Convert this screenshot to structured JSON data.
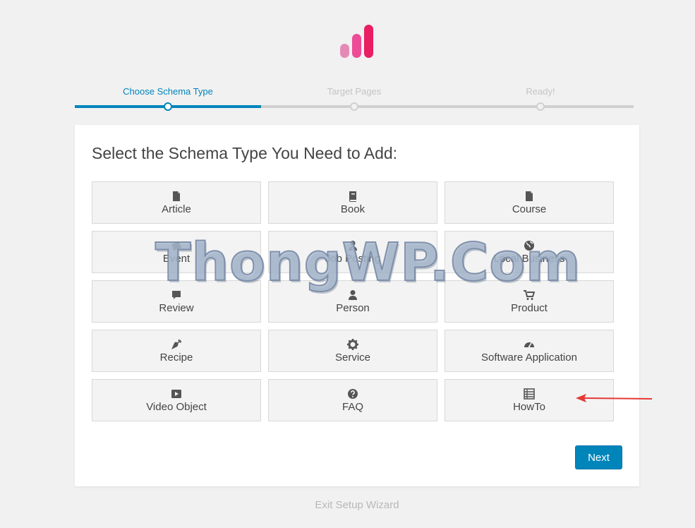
{
  "logo": {
    "bar_colors": [
      "#e58ab5",
      "#ec4d96",
      "#e91e63"
    ]
  },
  "steps": [
    {
      "label": "Choose Schema Type",
      "active": true
    },
    {
      "label": "Target Pages",
      "active": false
    },
    {
      "label": "Ready!",
      "active": false
    }
  ],
  "colors": {
    "accent": "#0085ba",
    "arrow": "#e53935"
  },
  "card": {
    "title": "Select the Schema Type You Need to Add:"
  },
  "schema_types": [
    {
      "label": "Article",
      "icon": "file-icon"
    },
    {
      "label": "Book",
      "icon": "book-icon"
    },
    {
      "label": "Course",
      "icon": "file-icon"
    },
    {
      "label": "Event",
      "icon": "ticket-icon"
    },
    {
      "label": "Job Posting",
      "icon": "user-tie-icon"
    },
    {
      "label": "Local Business",
      "icon": "globe-icon"
    },
    {
      "label": "Review",
      "icon": "comment-icon"
    },
    {
      "label": "Person",
      "icon": "user-icon"
    },
    {
      "label": "Product",
      "icon": "cart-icon"
    },
    {
      "label": "Recipe",
      "icon": "carrot-icon"
    },
    {
      "label": "Service",
      "icon": "gear-icon"
    },
    {
      "label": "Software Application",
      "icon": "gauge-icon"
    },
    {
      "label": "Video Object",
      "icon": "play-icon"
    },
    {
      "label": "FAQ",
      "icon": "question-icon"
    },
    {
      "label": "HowTo",
      "icon": "list-icon"
    }
  ],
  "buttons": {
    "next": "Next"
  },
  "footer": {
    "exit": "Exit Setup Wizard"
  },
  "watermark": {
    "text": "ThongWP.Com"
  }
}
